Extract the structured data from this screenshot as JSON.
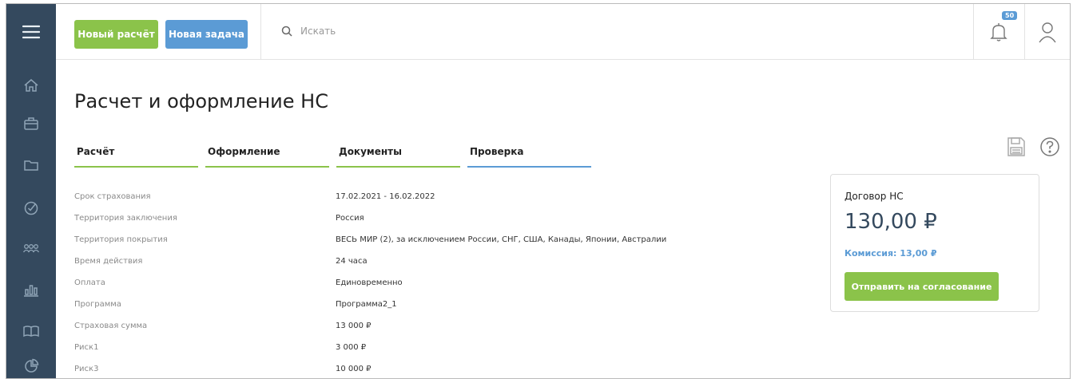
{
  "sidebar": {
    "items": [
      {
        "icon": "menu-icon"
      },
      {
        "icon": "home-icon"
      },
      {
        "icon": "briefcase-icon"
      },
      {
        "icon": "folder-icon"
      },
      {
        "icon": "check-circle-icon"
      },
      {
        "icon": "users-icon"
      },
      {
        "icon": "bar-chart-icon"
      },
      {
        "icon": "book-icon"
      },
      {
        "icon": "pie-chart-icon"
      }
    ]
  },
  "header": {
    "new_calc_label": "Новый расчёт",
    "new_task_label": "Новая задача",
    "search_placeholder": "Искать",
    "notification_count": "50"
  },
  "page": {
    "title": "Расчет и оформление НС"
  },
  "tabs": [
    {
      "label": "Расчёт"
    },
    {
      "label": "Оформление"
    },
    {
      "label": "Документы"
    },
    {
      "label": "Проверка",
      "active": true
    }
  ],
  "properties": [
    {
      "label": "Срок страхования",
      "value": "17.02.2021 - 16.02.2022"
    },
    {
      "label": "Территория заключения",
      "value": "Россия"
    },
    {
      "label": "Территория покрытия",
      "value": "ВЕСЬ МИР (2), за исключением России, СНГ, США, Канады, Японии, Австралии"
    },
    {
      "label": "Время действия",
      "value": "24 часа"
    },
    {
      "label": "Оплата",
      "value": "Единовременно"
    },
    {
      "label": "Программа",
      "value": "Программа2_1"
    },
    {
      "label": "Страховая сумма",
      "value": "13 000 ₽"
    },
    {
      "label": "Риск1",
      "value": "3 000 ₽"
    },
    {
      "label": "Риск3",
      "value": "10 000 ₽"
    }
  ],
  "summary": {
    "title": "Договор НС",
    "price": "130,00 ₽",
    "commission": "Комиссия: 13,00 ₽",
    "submit_label": "Отправить на согласование"
  },
  "colors": {
    "sidebar": "#34495e",
    "green": "#8bc34a",
    "blue": "#5b9bd5"
  }
}
